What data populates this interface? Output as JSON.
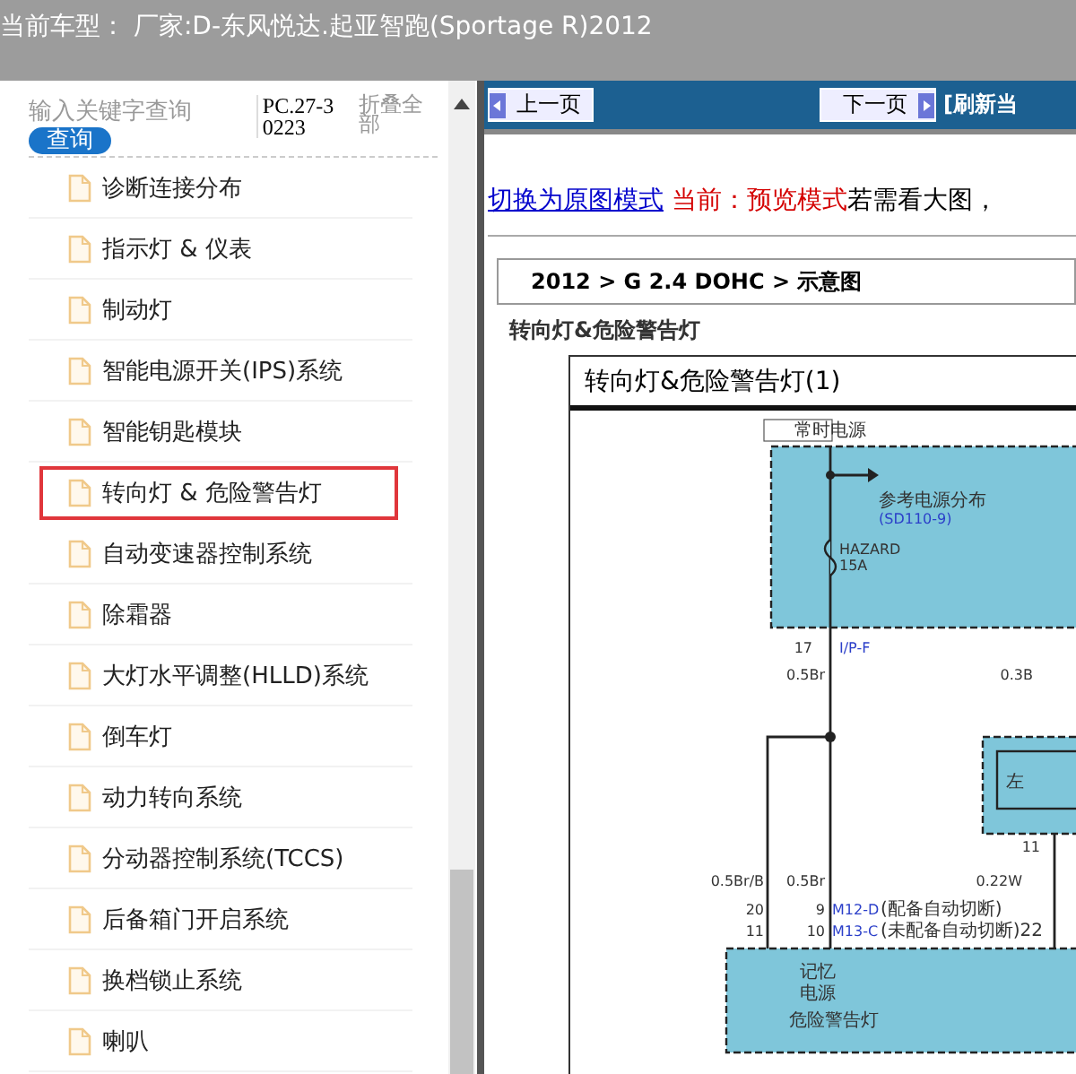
{
  "header": {
    "title": "当前车型： 厂家:D-东风悦达.起亚智跑(Sportage R)2012"
  },
  "sidebar": {
    "search": {
      "placeholder": "输入关键字查询",
      "button": "查询"
    },
    "code": "PC.27-30223",
    "collapse": "折叠全部",
    "items": [
      {
        "label": "诊断连接分布",
        "selected": false
      },
      {
        "label": "指示灯 & 仪表",
        "selected": false
      },
      {
        "label": "制动灯",
        "selected": false
      },
      {
        "label": "智能电源开关(IPS)系统",
        "selected": false
      },
      {
        "label": "智能钥匙模块",
        "selected": false
      },
      {
        "label": "转向灯 & 危险警告灯",
        "selected": true
      },
      {
        "label": "自动变速器控制系统",
        "selected": false
      },
      {
        "label": "除霜器",
        "selected": false
      },
      {
        "label": "大灯水平调整(HLLD)系统",
        "selected": false
      },
      {
        "label": "倒车灯",
        "selected": false
      },
      {
        "label": "动力转向系统",
        "selected": false
      },
      {
        "label": "分动器控制系统(TCCS)",
        "selected": false
      },
      {
        "label": "后备箱门开启系统",
        "selected": false
      },
      {
        "label": "换档锁止系统",
        "selected": false
      },
      {
        "label": "喇叭",
        "selected": false
      }
    ]
  },
  "toolbar": {
    "prev": "上一页",
    "next": "下一页",
    "refresh": "[刷新当"
  },
  "mode_line": {
    "link": "切换为原图模式",
    "current": "当前：预览模式",
    "hint": "若需看大图，"
  },
  "breadcrumb": "2012 > G 2.4 DOHC > 示意图",
  "section_title": "转向灯&危险警告灯",
  "diagram": {
    "title": "转向灯&危险警告灯(1)",
    "labels": [
      "常时电源",
      "参考电源分布",
      "(SD110-9)",
      "HAZARD",
      "15A",
      "17",
      "I/P-F",
      "0.5Br",
      "0.3B",
      "左",
      "11",
      "0.5Br/B",
      "0.5Br",
      "0.22W",
      "20",
      "11",
      "9",
      "10",
      "M12-D",
      "(配备自动切断)",
      "M13-C",
      "(未配备自动切断)22",
      "记忆",
      "电源",
      "危险警告灯"
    ]
  }
}
